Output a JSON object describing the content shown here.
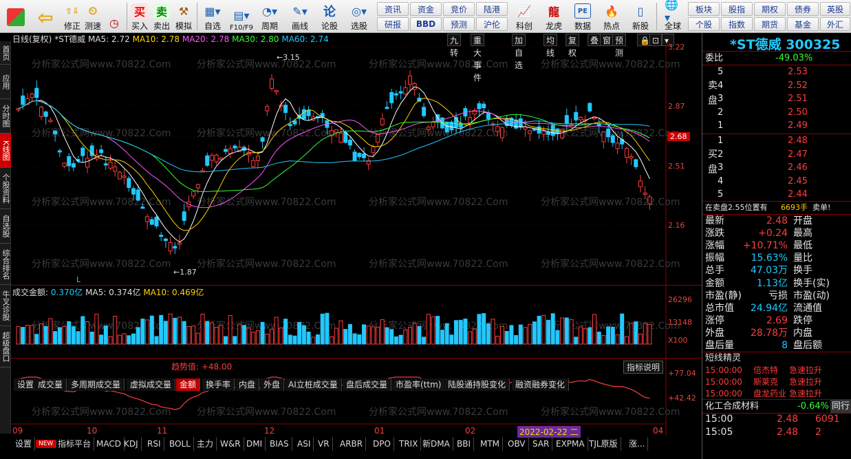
{
  "toolbar": {
    "main": [
      {
        "icon": "back-icon",
        "label": ""
      },
      {
        "icon": "modify-icon",
        "label": "修正"
      },
      {
        "icon": "clock-icon",
        "label": "测速"
      },
      {
        "icon": "buy-icon",
        "label": "买入",
        "glyph": "买"
      },
      {
        "icon": "sell-icon",
        "label": "卖出",
        "glyph": "卖"
      },
      {
        "icon": "hammer-icon",
        "label": "模拟"
      },
      {
        "icon": "watchlist-icon",
        "label": "自选"
      },
      {
        "icon": "f10-icon",
        "label": "F10/F9"
      },
      {
        "icon": "period-icon",
        "label": "周期"
      },
      {
        "icon": "draw-icon",
        "label": "画线"
      },
      {
        "icon": "forum-icon",
        "label": "论股"
      },
      {
        "icon": "stock-picker-icon",
        "label": "选股"
      }
    ],
    "row1": [
      "资讯",
      "资金",
      "竞价",
      "陆港"
    ],
    "row2": [
      "研报",
      "BBD",
      "预测",
      "沪伦"
    ],
    "main2": [
      {
        "icon": "compare-icon",
        "label": "科创"
      },
      {
        "icon": "dragon-tiger-icon",
        "label": "龙虎"
      },
      {
        "icon": "pe-icon",
        "label": "数据"
      },
      {
        "icon": "hot-icon",
        "label": "热点"
      },
      {
        "icon": "new-stock-icon",
        "label": "新股"
      },
      {
        "icon": "globe-icon",
        "label": "全球"
      }
    ],
    "right1": [
      "板块",
      "股指",
      "期权",
      "债券",
      "英股"
    ],
    "right2": [
      "个股",
      "指数",
      "期货",
      "基金",
      "外汇"
    ]
  },
  "left_tabs": [
    "首页",
    "应用",
    "分时图",
    "K线图",
    "个股资料",
    "自选股",
    "综合排名",
    "牛叉诊股",
    "超级盘口"
  ],
  "chart": {
    "header": {
      "period": "日线(复权)",
      "name": "*ST德威",
      "ma5": "MA5: 2.72",
      "ma10": "MA10: 2.78",
      "ma20": "MA20: 2.78",
      "ma30": "MA30: 2.80",
      "ma60": "MA60: 2.74"
    },
    "tools": [
      "九转",
      "重大事件",
      "加自选",
      "均线",
      "复权",
      "叠",
      "窗",
      "预测"
    ],
    "price_axis": [
      "3.22",
      "2.87",
      "2.68",
      "2.51",
      "2.16"
    ],
    "high_mark": "3.15",
    "low_mark": "1.87",
    "vol_header": {
      "name": "成交金额:",
      "value": "0.370亿",
      "ma5": "MA5: 0.374亿",
      "ma10": "MA10: 0.469亿"
    },
    "vol_axis": [
      "26296",
      "13148",
      "X100"
    ],
    "tabs": [
      "设置",
      "成交量",
      "多周期成交量",
      "虚拟成交量",
      "金额",
      "换手率",
      "内盘",
      "外盘",
      "AI立桩成交量",
      "盘后成交量",
      "市盈率(ttm)",
      "陆股通持股变化",
      "融资融券变化"
    ],
    "active_tab": "金额",
    "ind_label": "趋势值: +48.00",
    "ind_btn": "指标说明",
    "ind_axis": [
      "+77.04",
      "+42.42"
    ],
    "x_axis": [
      "09",
      "10",
      "11",
      "12",
      "01",
      "02",
      "04"
    ],
    "cursor_date": "2022-02-22 二",
    "bottom_tabs": [
      "设置",
      "NEW",
      "指标平台",
      "MACD",
      "KDJ",
      "RSI",
      "BOLL",
      "主力",
      "W&R",
      "DMI",
      "BIAS",
      "ASI",
      "VR",
      "ARBR",
      "DPO",
      "TRIX",
      "新DMA",
      "BBI",
      "MTM",
      "OBV",
      "SAR",
      "EXPMA",
      "TJL原版",
      "涨..."
    ],
    "watermark": "分析家公式网www.70822.Com",
    "colors": {
      "up": "#ff3c3c",
      "down": "#22c8ff",
      "ma5": "#ffffff",
      "ma10": "#ffd500",
      "ma20": "#ff55ff",
      "ma30": "#33ff33",
      "ma60": "#22c8ff"
    }
  },
  "quote": {
    "title": "*ST德威 300325",
    "weibi_label": "委比",
    "weibi": "-49.03%",
    "sell_label": "卖盘",
    "buy_label": "买盘",
    "sell": [
      {
        "lvl": "5",
        "price": "2.53"
      },
      {
        "lvl": "4",
        "price": "2.52"
      },
      {
        "lvl": "3",
        "price": "2.51"
      },
      {
        "lvl": "2",
        "price": "2.50"
      },
      {
        "lvl": "1",
        "price": "2.49"
      }
    ],
    "buy": [
      {
        "lvl": "1",
        "price": "2.48"
      },
      {
        "lvl": "2",
        "price": "2.47"
      },
      {
        "lvl": "3",
        "price": "2.46"
      },
      {
        "lvl": "4",
        "price": "2.45"
      },
      {
        "lvl": "5",
        "price": "2.44"
      }
    ],
    "notice": "在卖盘2.55位置有",
    "notice_qty": "6693手",
    "notice_act": "卖单!",
    "stats": [
      {
        "l": "最新",
        "v": "2.48",
        "r": "开盘",
        "vc": "red"
      },
      {
        "l": "涨跌",
        "v": "+0.24",
        "r": "最高",
        "vc": "red"
      },
      {
        "l": "涨幅",
        "v": "+10.71%",
        "r": "最低",
        "vc": "red"
      },
      {
        "l": "振幅",
        "v": "15.63%",
        "r": "量比",
        "vc": "cyan"
      },
      {
        "l": "总手",
        "v": "47.03万",
        "r": "换手",
        "vc": "cyan"
      },
      {
        "l": "金额",
        "v": "1.13亿",
        "r": "换手(实)",
        "vc": "cyan"
      },
      {
        "l": "市盈(静)",
        "v": "亏损",
        "r": "市盈(动)",
        "vc": "white"
      },
      {
        "l": "总市值",
        "v": "24.94亿",
        "r": "流通值",
        "vc": "cyan"
      },
      {
        "l": "涨停",
        "v": "2.69",
        "r": "跌停",
        "vc": "red"
      },
      {
        "l": "外盘",
        "v": "28.78万",
        "r": "内盘",
        "vc": "red"
      },
      {
        "l": "盘后量",
        "v": "8",
        "r": "盘后额",
        "vc": "cyan"
      }
    ],
    "section": "短线精灵",
    "alerts": [
      {
        "t": "15:00:00",
        "n": "倍杰特",
        "a": "急速拉升"
      },
      {
        "t": "15:00:00",
        "n": "斯莱克",
        "a": "急速拉升"
      },
      {
        "t": "15:00:00",
        "n": "盘龙药业",
        "a": "急速拉升"
      }
    ],
    "sector": "化工合成材料",
    "sector_chg": "-0.64%",
    "sector_more": "同行",
    "ticks": [
      {
        "t": "15:00",
        "p": "2.48",
        "q": "6091"
      },
      {
        "t": "15:05",
        "p": "2.48",
        "q": "2"
      }
    ]
  }
}
